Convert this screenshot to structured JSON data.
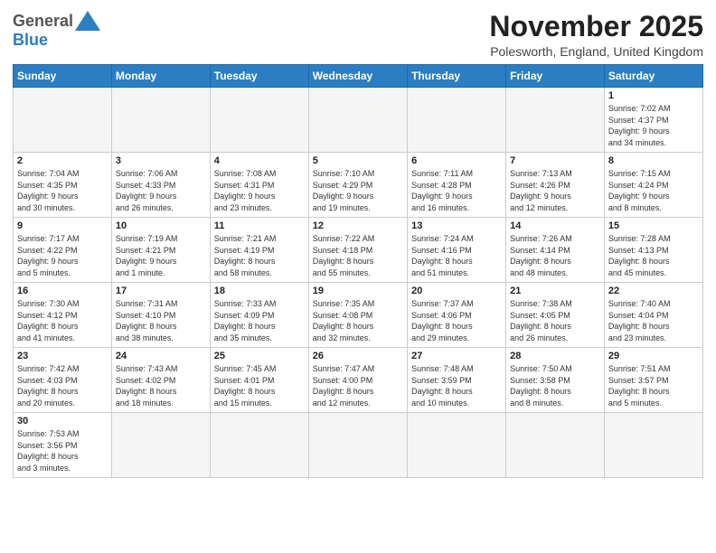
{
  "header": {
    "logo_general": "General",
    "logo_blue": "Blue",
    "title": "November 2025",
    "subtitle": "Polesworth, England, United Kingdom"
  },
  "weekdays": [
    "Sunday",
    "Monday",
    "Tuesday",
    "Wednesday",
    "Thursday",
    "Friday",
    "Saturday"
  ],
  "weeks": [
    [
      {
        "day": "",
        "info": ""
      },
      {
        "day": "",
        "info": ""
      },
      {
        "day": "",
        "info": ""
      },
      {
        "day": "",
        "info": ""
      },
      {
        "day": "",
        "info": ""
      },
      {
        "day": "",
        "info": ""
      },
      {
        "day": "1",
        "info": "Sunrise: 7:02 AM\nSunset: 4:37 PM\nDaylight: 9 hours\nand 34 minutes."
      }
    ],
    [
      {
        "day": "2",
        "info": "Sunrise: 7:04 AM\nSunset: 4:35 PM\nDaylight: 9 hours\nand 30 minutes."
      },
      {
        "day": "3",
        "info": "Sunrise: 7:06 AM\nSunset: 4:33 PM\nDaylight: 9 hours\nand 26 minutes."
      },
      {
        "day": "4",
        "info": "Sunrise: 7:08 AM\nSunset: 4:31 PM\nDaylight: 9 hours\nand 23 minutes."
      },
      {
        "day": "5",
        "info": "Sunrise: 7:10 AM\nSunset: 4:29 PM\nDaylight: 9 hours\nand 19 minutes."
      },
      {
        "day": "6",
        "info": "Sunrise: 7:11 AM\nSunset: 4:28 PM\nDaylight: 9 hours\nand 16 minutes."
      },
      {
        "day": "7",
        "info": "Sunrise: 7:13 AM\nSunset: 4:26 PM\nDaylight: 9 hours\nand 12 minutes."
      },
      {
        "day": "8",
        "info": "Sunrise: 7:15 AM\nSunset: 4:24 PM\nDaylight: 9 hours\nand 8 minutes."
      }
    ],
    [
      {
        "day": "9",
        "info": "Sunrise: 7:17 AM\nSunset: 4:22 PM\nDaylight: 9 hours\nand 5 minutes."
      },
      {
        "day": "10",
        "info": "Sunrise: 7:19 AM\nSunset: 4:21 PM\nDaylight: 9 hours\nand 1 minute."
      },
      {
        "day": "11",
        "info": "Sunrise: 7:21 AM\nSunset: 4:19 PM\nDaylight: 8 hours\nand 58 minutes."
      },
      {
        "day": "12",
        "info": "Sunrise: 7:22 AM\nSunset: 4:18 PM\nDaylight: 8 hours\nand 55 minutes."
      },
      {
        "day": "13",
        "info": "Sunrise: 7:24 AM\nSunset: 4:16 PM\nDaylight: 8 hours\nand 51 minutes."
      },
      {
        "day": "14",
        "info": "Sunrise: 7:26 AM\nSunset: 4:14 PM\nDaylight: 8 hours\nand 48 minutes."
      },
      {
        "day": "15",
        "info": "Sunrise: 7:28 AM\nSunset: 4:13 PM\nDaylight: 8 hours\nand 45 minutes."
      }
    ],
    [
      {
        "day": "16",
        "info": "Sunrise: 7:30 AM\nSunset: 4:12 PM\nDaylight: 8 hours\nand 41 minutes."
      },
      {
        "day": "17",
        "info": "Sunrise: 7:31 AM\nSunset: 4:10 PM\nDaylight: 8 hours\nand 38 minutes."
      },
      {
        "day": "18",
        "info": "Sunrise: 7:33 AM\nSunset: 4:09 PM\nDaylight: 8 hours\nand 35 minutes."
      },
      {
        "day": "19",
        "info": "Sunrise: 7:35 AM\nSunset: 4:08 PM\nDaylight: 8 hours\nand 32 minutes."
      },
      {
        "day": "20",
        "info": "Sunrise: 7:37 AM\nSunset: 4:06 PM\nDaylight: 8 hours\nand 29 minutes."
      },
      {
        "day": "21",
        "info": "Sunrise: 7:38 AM\nSunset: 4:05 PM\nDaylight: 8 hours\nand 26 minutes."
      },
      {
        "day": "22",
        "info": "Sunrise: 7:40 AM\nSunset: 4:04 PM\nDaylight: 8 hours\nand 23 minutes."
      }
    ],
    [
      {
        "day": "23",
        "info": "Sunrise: 7:42 AM\nSunset: 4:03 PM\nDaylight: 8 hours\nand 20 minutes."
      },
      {
        "day": "24",
        "info": "Sunrise: 7:43 AM\nSunset: 4:02 PM\nDaylight: 8 hours\nand 18 minutes."
      },
      {
        "day": "25",
        "info": "Sunrise: 7:45 AM\nSunset: 4:01 PM\nDaylight: 8 hours\nand 15 minutes."
      },
      {
        "day": "26",
        "info": "Sunrise: 7:47 AM\nSunset: 4:00 PM\nDaylight: 8 hours\nand 12 minutes."
      },
      {
        "day": "27",
        "info": "Sunrise: 7:48 AM\nSunset: 3:59 PM\nDaylight: 8 hours\nand 10 minutes."
      },
      {
        "day": "28",
        "info": "Sunrise: 7:50 AM\nSunset: 3:58 PM\nDaylight: 8 hours\nand 8 minutes."
      },
      {
        "day": "29",
        "info": "Sunrise: 7:51 AM\nSunset: 3:57 PM\nDaylight: 8 hours\nand 5 minutes."
      }
    ],
    [
      {
        "day": "30",
        "info": "Sunrise: 7:53 AM\nSunset: 3:56 PM\nDaylight: 8 hours\nand 3 minutes."
      },
      {
        "day": "",
        "info": ""
      },
      {
        "day": "",
        "info": ""
      },
      {
        "day": "",
        "info": ""
      },
      {
        "day": "",
        "info": ""
      },
      {
        "day": "",
        "info": ""
      },
      {
        "day": "",
        "info": ""
      }
    ]
  ]
}
